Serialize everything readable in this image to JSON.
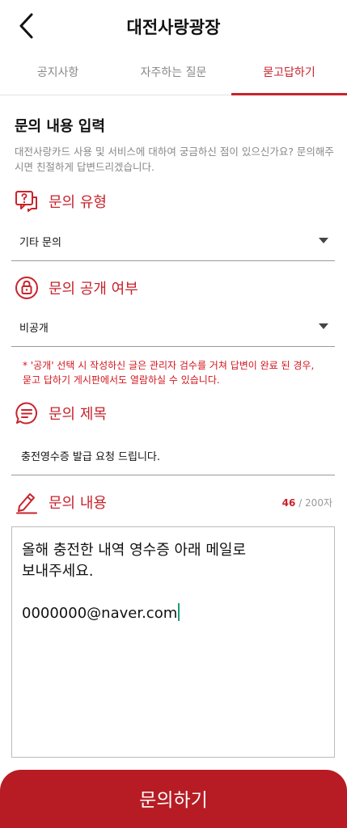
{
  "header": {
    "title": "대전사랑광장"
  },
  "tabs": [
    {
      "label": "공지사항"
    },
    {
      "label": "자주하는 질문"
    },
    {
      "label": "묻고답하기"
    }
  ],
  "form": {
    "section_title": "문의 내용 입력",
    "description": "대전사랑카드 사용 및 서비스에 대하여 궁금하신 점이 있으신가요? 문의해주시면 친절하게 답변드리겠습니다.",
    "inquiry_type": {
      "label": "문의 유형",
      "value": "기타 문의"
    },
    "visibility": {
      "label": "문의 공개 여부",
      "value": "비공개",
      "notice": "* '공개' 선택 시 작성하신 글은 관리자 검수를 거쳐 답변이 완료 된 경우, 묻고 답하기 게시판에서도 열람하실 수 있습니다."
    },
    "subject": {
      "label": "문의 제목",
      "value": "충전영수증 발급 요청 드립니다."
    },
    "content": {
      "label": "문의 내용",
      "count": "46",
      "max": " / 200자",
      "value": "올해 충전한 내역 영수증 아래 메일로\n보내주세요.\n\n0000000@naver.com"
    }
  },
  "submit_label": "문의하기",
  "colors": {
    "accent": "#c8232c",
    "button": "#b71c24",
    "cursor": "#1a9b7b"
  }
}
